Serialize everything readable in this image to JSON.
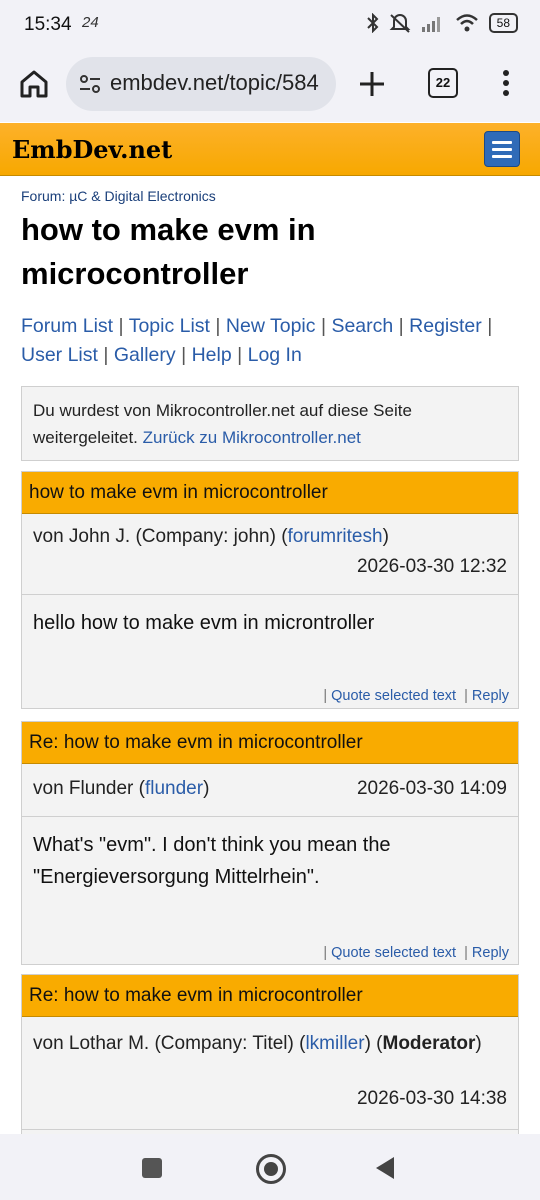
{
  "status": {
    "time": "15:34",
    "extra": "24",
    "battery": "58"
  },
  "browser": {
    "url": "embdev.net/topic/584",
    "tab_count": "22"
  },
  "site": {
    "logo": "EmbDev.net"
  },
  "breadcrumb": {
    "label": "Forum:",
    "forum": "µC & Digital Electronics"
  },
  "topic": {
    "title": "how to make evm in microcontroller"
  },
  "nav": {
    "forum_list": "Forum List",
    "topic_list": "Topic List",
    "new_topic": "New Topic",
    "search": "Search",
    "register": "Register",
    "user_list": "User List",
    "gallery": "Gallery",
    "help": "Help",
    "login": "Log In",
    "sep": "|"
  },
  "notice": {
    "text": "Du wurdest von Mikrocontroller.net auf diese Seite weitergeleitet.",
    "link": "Zurück zu Mikrocontroller.net"
  },
  "posts": [
    {
      "subject": "how to make evm in microcontroller",
      "von": "von",
      "author": "John J. (Company: john)",
      "username": "forumritesh",
      "date": "2026-03-30 12:32",
      "body": "hello how to make evm in microntroller",
      "quote": "Quote selected text",
      "reply": "Reply"
    },
    {
      "subject": "Re: how to make evm in microcontroller",
      "von": "von",
      "author": "Flunder",
      "username": "flunder",
      "date": "2026-03-30 14:09",
      "body": "What's \"evm\". I don't think you mean the \"Energieversorgung Mittelrhein\".",
      "quote": "Quote selected text",
      "reply": "Reply"
    },
    {
      "subject": "Re: how to make evm in microcontroller",
      "von": "von",
      "author": "Lothar M. (Company: Titel)",
      "username": "lkmiller",
      "role": "Moderator",
      "date": "2026-03-30 14:38"
    }
  ]
}
